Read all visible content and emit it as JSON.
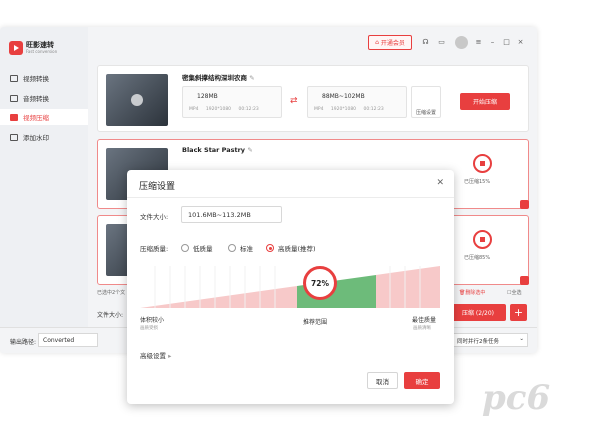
{
  "app": {
    "brand": "旺影速转",
    "brand_sub": "Fast conversion",
    "vip_label": "开通会员",
    "nav": [
      "视频转换",
      "音频转换",
      "视频压缩",
      "添加水印"
    ]
  },
  "cards": [
    {
      "title": "密集斜撑结构深圳农商",
      "src_size": "128MB",
      "src_meta": "MP4 1920*1080 00:12:23",
      "dst_size": "88MB~102MB",
      "dst_meta": "MP4 1920*1080 00:12:23",
      "settings_label": "压缩设置",
      "start_label": "开始压缩"
    },
    {
      "title": "Black Star Pastry",
      "progress_text": "已压缩15%",
      "progress": 0.15
    },
    {
      "progress_text": "已压缩85%",
      "progress": 0.85
    }
  ],
  "bottom": {
    "selected_text": "已选中2个文",
    "delete_label": "删除选中",
    "select_all_label": "全选",
    "filesize_label": "文件大小:",
    "compress_all_label": "压缩 (2/20)",
    "output_label": "输出路径:",
    "output_value": "Converted",
    "parallel_label": "同时并行2条任务"
  },
  "dialog": {
    "title": "压缩设置",
    "filesize_label": "文件大小:",
    "filesize_value": "101.6MB~113.2MB",
    "quality_label": "压缩质量:",
    "quality_options": [
      "低质量",
      "标准",
      "高质量(推荐)"
    ],
    "quality_selected": "高质量(推荐)",
    "slider_value": "72%",
    "slider_fraction": 0.72,
    "left_label": "体积较小",
    "left_sub": "画质受损",
    "middle_label": "推荐范围",
    "right_label": "最佳质量",
    "right_sub": "画质清晰",
    "advanced_label": "高级设置",
    "cancel_label": "取消",
    "ok_label": "确定"
  },
  "colors": {
    "accent": "#e83f3f",
    "recommend_band": "#6dbb7a",
    "ramp": "#f3b6b6"
  },
  "watermark": "pc6"
}
